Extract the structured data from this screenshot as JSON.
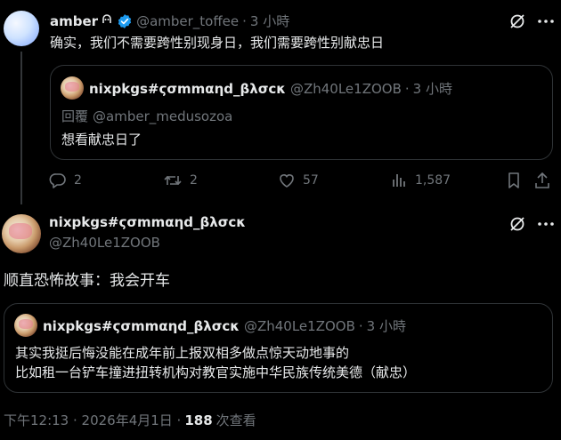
{
  "tweet1": {
    "author_name": "amber",
    "author_handle": "@amber_toffee",
    "dot": "·",
    "time": "3 小時",
    "text": "确实，我们不需要跨性别现身日，我们需要跨性别献忠日",
    "quote": {
      "author_name": "nixpkgs#ϛσmmαηd_βλσϲκ",
      "author_handle": "@Zh40Le1ZOOB",
      "dot": "·",
      "time": "3 小時",
      "reply_prefix": "回覆",
      "reply_to": "@amber_medusozoa",
      "text": "想看献忠日了"
    },
    "actions": {
      "replies": "2",
      "retweets": "2",
      "likes": "57",
      "views": "1,587"
    }
  },
  "tweet2": {
    "author_name": "nixpkgs#ϛσmmαηd_βλσϲκ",
    "author_handle": "@Zh40Le1ZOOB",
    "text": "顺直恐怖故事：我会开车",
    "quote": {
      "author_name": "nixpkgs#ϛσmmαηd_βλσϲκ",
      "author_handle": "@Zh40Le1ZOOB",
      "dot": "·",
      "time": "3 小時",
      "line1": "其实我挺后悔没能在成年前上报双相多做点惊天动地事的",
      "line2": "比如租一台铲车撞进扭转机构对教官实施中华民族传统美德（献忠）"
    },
    "meta": {
      "timestamp": "下午12:13 · 2026年4月1日 ·",
      "views_count": "188",
      "views_label": "次查看"
    }
  },
  "colors": {
    "background": "#000000",
    "text": "#e7e9ea",
    "muted": "#71767b",
    "border": "#2f3336",
    "verified": "#1d9bf0"
  }
}
